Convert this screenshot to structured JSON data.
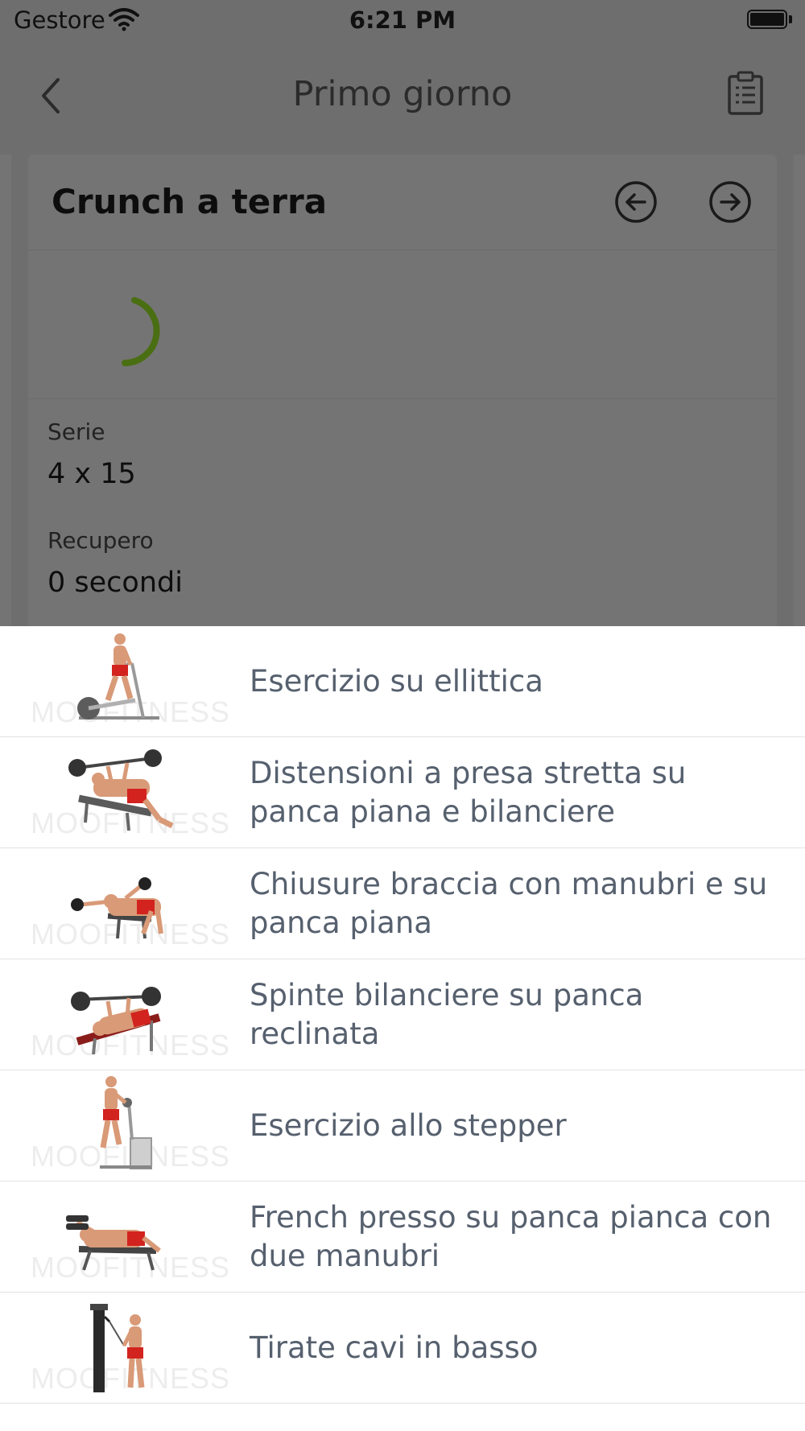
{
  "status_bar": {
    "carrier": "Gestore",
    "time": "6:21 PM",
    "wifi_icon": "wifi-icon",
    "battery_icon": "battery-icon"
  },
  "nav": {
    "title": "Primo giorno",
    "back_icon": "chevron-left-icon",
    "right_icon": "clipboard-icon"
  },
  "exercise_card": {
    "title": "Crunch a terra",
    "prev_icon": "arrow-left-circle-icon",
    "next_icon": "arrow-right-circle-icon",
    "loading_icon": "spinner-icon",
    "series_label": "Serie",
    "series_value": "4 x 15",
    "rest_label": "Recupero",
    "rest_value": "0 secondi"
  },
  "exercise_list": {
    "watermark": "MOOFITNESS",
    "items": [
      {
        "name": "Esercizio su ellittica"
      },
      {
        "name": "Distensioni a presa stretta su panca piana e bilanciere"
      },
      {
        "name": "Chiusure braccia con manubri e su panca piana"
      },
      {
        "name": "Spinte bilanciere su panca reclinata"
      },
      {
        "name": "Esercizio allo stepper"
      },
      {
        "name": "French presso su panca pianca con due manubri"
      },
      {
        "name": "Tirate cavi in basso"
      }
    ]
  },
  "colors": {
    "overlay_gray": "#6e6e6e",
    "card_gray": "#747474",
    "spinner_green": "#4a6e12",
    "list_text": "#56606e",
    "skin": "#d99a78",
    "shorts_red": "#d2231e"
  }
}
